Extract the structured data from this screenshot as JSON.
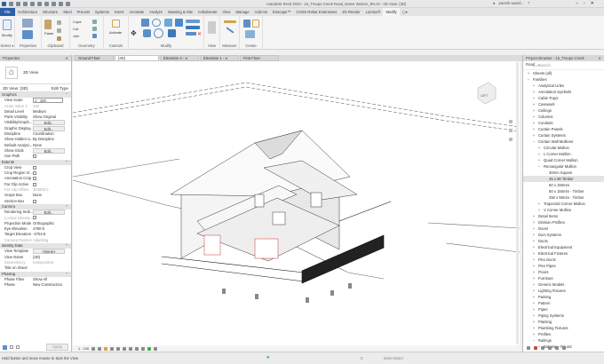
{
  "app": {
    "title": "Autodesk Revit 2023 - 15_Troupo Creek Road_Name Warren_R0.rvt - 3D View: {3D}",
    "user": "paresh.wanid...",
    "help": "?"
  },
  "menu_tabs": [
    "File",
    "Architecture",
    "Structure",
    "Steel",
    "Precast",
    "Systems",
    "Insert",
    "Annotate",
    "Analyze",
    "Massing & Site",
    "Collaborate",
    "View",
    "Manage",
    "Add-Ins",
    "Enscape™",
    "CADS Rebar Extensions",
    "ZS Render",
    "Lumion®",
    "Modify",
    "▢▾"
  ],
  "active_tab": "Modify",
  "ribbon": {
    "panels": [
      "Select ▾",
      "Properties",
      "Clipboard",
      "Geometry",
      "Controls",
      "Modify",
      "View",
      "Measure",
      "Create"
    ],
    "buttons": {
      "modify": "Modify",
      "paste": "Paste",
      "cope": "Cope",
      "cut": "Cut",
      "join": "Join",
      "activate": "Activate"
    }
  },
  "properties": {
    "header": "Properties",
    "type_name": "3D View",
    "selector": "3D View: {3D}",
    "edit_type": "Edit Type",
    "sections": [
      {
        "name": "Graphics",
        "rows": [
          {
            "k": "View Scale",
            "v": "1 : 100",
            "kind": "input"
          },
          {
            "k": "Scale Value  1:",
            "v": "100",
            "kind": "dim"
          },
          {
            "k": "Detail Level",
            "v": "Medium"
          },
          {
            "k": "Parts Visibility",
            "v": "Show Original"
          },
          {
            "k": "Visibility/Graph...",
            "v": "Edit...",
            "kind": "button"
          },
          {
            "k": "Graphic Display...",
            "v": "Edit...",
            "kind": "button"
          },
          {
            "k": "Discipline",
            "v": "Coordination"
          },
          {
            "k": "Show Hidden Li...",
            "v": "By Discipline"
          },
          {
            "k": "Default Analysi...",
            "v": "None"
          },
          {
            "k": "Show Grids",
            "v": "Edit...",
            "kind": "button"
          },
          {
            "k": "Sun Path",
            "v": "",
            "kind": "check"
          }
        ]
      },
      {
        "name": "Extents",
        "rows": [
          {
            "k": "Crop View",
            "v": "",
            "kind": "check"
          },
          {
            "k": "Crop Region Vi...",
            "v": "",
            "kind": "check"
          },
          {
            "k": "Annotation Crop",
            "v": "",
            "kind": "check"
          },
          {
            "k": "Far Clip Active",
            "v": "",
            "kind": "check"
          },
          {
            "k": "Far Clip Offset",
            "v": "304800.0",
            "kind": "dim"
          },
          {
            "k": "Scope Box",
            "v": "None"
          },
          {
            "k": "Section Box",
            "v": "",
            "kind": "check"
          }
        ]
      },
      {
        "name": "Camera",
        "rows": [
          {
            "k": "Rendering Setti...",
            "v": "Edit...",
            "kind": "button"
          },
          {
            "k": "Locked Orienta...",
            "v": "",
            "kind": "dimcheck"
          },
          {
            "k": "Projection Mode",
            "v": "Orthographic"
          },
          {
            "k": "Eye Elevation",
            "v": "4780.9"
          },
          {
            "k": "Target Elevation",
            "v": "-4704.8"
          },
          {
            "k": "Camera Position",
            "v": "Adjusting",
            "kind": "dim"
          }
        ]
      },
      {
        "name": "Identity Data",
        "rows": [
          {
            "k": "View Template",
            "v": "<None>",
            "kind": "button"
          },
          {
            "k": "View Name",
            "v": "{3D}"
          },
          {
            "k": "Dependency",
            "v": "Independent",
            "kind": "dim"
          },
          {
            "k": "Title on Sheet",
            "v": ""
          }
        ]
      },
      {
        "name": "Phasing",
        "rows": [
          {
            "k": "Phase Filter",
            "v": "Show All"
          },
          {
            "k": "Phase",
            "v": "New Construction"
          }
        ]
      }
    ],
    "apply": "Apply"
  },
  "view_tabs": [
    "Ground Floor",
    "{3D}",
    "Elevation 4 - a",
    "Elevation 1 - a",
    "First Floor"
  ],
  "active_view_tab": "{3D}",
  "view_control": {
    "scale": "1 : 100"
  },
  "viewcube": {
    "face": "LEFT"
  },
  "browser": {
    "header": "Project Browser - 15_Troupo Creek Road_...",
    "search_placeholder": "Search",
    "items": [
      {
        "label": "Sheets (all)",
        "sign": "+",
        "level": 0
      },
      {
        "label": "Families",
        "sign": "−",
        "level": 0
      },
      {
        "label": "Analytical Links",
        "sign": "+",
        "level": 1
      },
      {
        "label": "Annotation Symbols",
        "sign": "+",
        "level": 1
      },
      {
        "label": "Cable Trays",
        "sign": "+",
        "level": 1
      },
      {
        "label": "Casework",
        "sign": "+",
        "level": 1
      },
      {
        "label": "Ceilings",
        "sign": "+",
        "level": 1
      },
      {
        "label": "Columns",
        "sign": "+",
        "level": 1
      },
      {
        "label": "Conduits",
        "sign": "+",
        "level": 1
      },
      {
        "label": "Curtain Panels",
        "sign": "+",
        "level": 1
      },
      {
        "label": "Curtain Systems",
        "sign": "+",
        "level": 1
      },
      {
        "label": "Curtain Wall Mullions",
        "sign": "−",
        "level": 1
      },
      {
        "label": "Circular Mullion",
        "sign": "+",
        "level": 2
      },
      {
        "label": "L Corner Mullion",
        "sign": "+",
        "level": 2
      },
      {
        "label": "Quad Corner Mullion",
        "sign": "+",
        "level": 2
      },
      {
        "label": "Rectangular Mullion",
        "sign": "−",
        "level": 2
      },
      {
        "label": "30mm Square",
        "sign": "",
        "level": 3
      },
      {
        "label": "45 x 90 Timber",
        "sign": "",
        "level": 3,
        "selected": true
      },
      {
        "label": "50 x 150mm",
        "sign": "",
        "level": 3
      },
      {
        "label": "50 x 150mm - Timber",
        "sign": "",
        "level": 3
      },
      {
        "label": "250 x 50mm - Timber",
        "sign": "",
        "level": 3
      },
      {
        "label": "Trapezoid Corner Mullion",
        "sign": "+",
        "level": 2
      },
      {
        "label": "V Corner Mullion",
        "sign": "+",
        "level": 2
      },
      {
        "label": "Detail Items",
        "sign": "+",
        "level": 1
      },
      {
        "label": "Division Profiles",
        "sign": "+",
        "level": 1
      },
      {
        "label": "Doors",
        "sign": "+",
        "level": 1
      },
      {
        "label": "Duct Systems",
        "sign": "+",
        "level": 1
      },
      {
        "label": "Ducts",
        "sign": "+",
        "level": 1
      },
      {
        "label": "Electrical Equipment",
        "sign": "+",
        "level": 1
      },
      {
        "label": "Electrical Fixtures",
        "sign": "+",
        "level": 1
      },
      {
        "label": "Flex Ducts",
        "sign": "+",
        "level": 1
      },
      {
        "label": "Flex Pipes",
        "sign": "+",
        "level": 1
      },
      {
        "label": "Floors",
        "sign": "+",
        "level": 1
      },
      {
        "label": "Furniture",
        "sign": "+",
        "level": 1
      },
      {
        "label": "Generic Models",
        "sign": "+",
        "level": 1
      },
      {
        "label": "Lighting Fixtures",
        "sign": "+",
        "level": 1
      },
      {
        "label": "Parking",
        "sign": "+",
        "level": 1
      },
      {
        "label": "Pattern",
        "sign": "+",
        "level": 1
      },
      {
        "label": "Pipes",
        "sign": "+",
        "level": 1
      },
      {
        "label": "Piping Systems",
        "sign": "+",
        "level": 1
      },
      {
        "label": "Planting",
        "sign": "+",
        "level": 1
      },
      {
        "label": "Plumbing Fixtures",
        "sign": "+",
        "level": 1
      },
      {
        "label": "Profiles",
        "sign": "+",
        "level": 1
      },
      {
        "label": "Railings",
        "sign": "−",
        "level": 1
      },
      {
        "label": "Baluster - Round",
        "sign": "+",
        "level": 2
      }
    ]
  },
  "status": {
    "message": "Hold button and move mouse to Spin the View",
    "model": "Main Model",
    "zero": ":0"
  }
}
